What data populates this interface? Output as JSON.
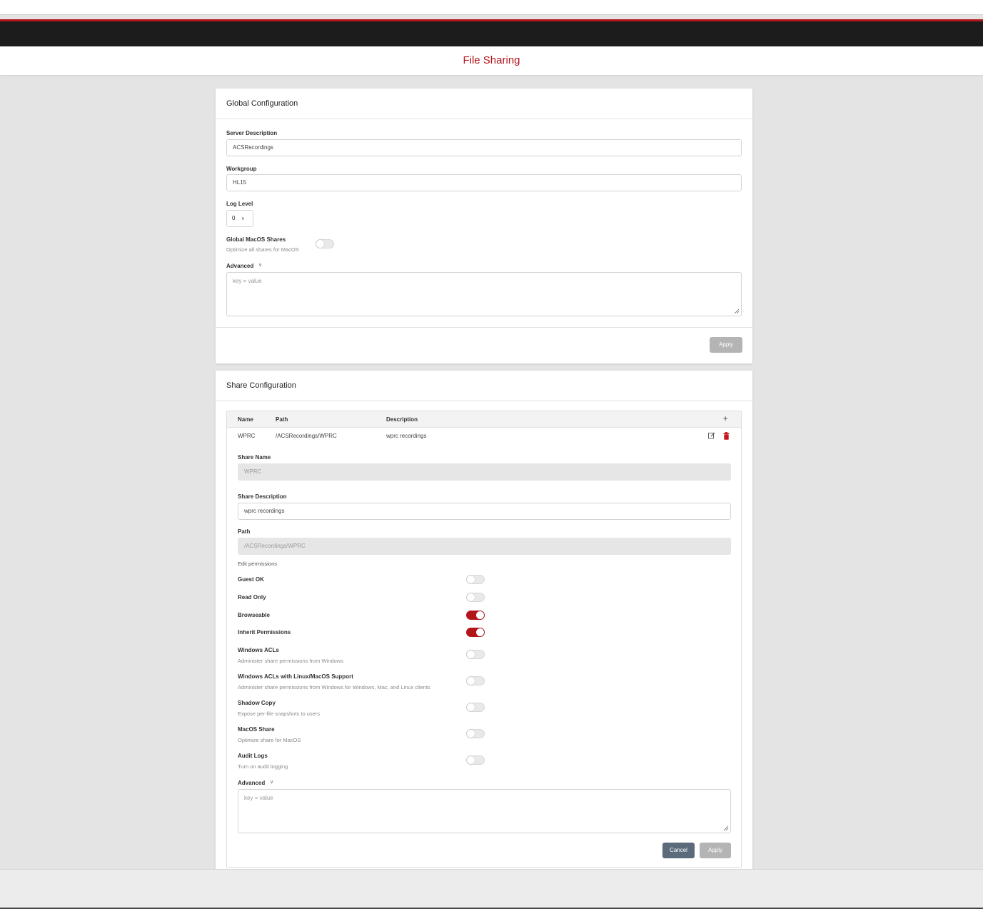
{
  "header": {
    "title": "File Sharing"
  },
  "global": {
    "heading": "Global Configuration",
    "server_description": {
      "label": "Server Description",
      "value": "ACSRecordings"
    },
    "workgroup": {
      "label": "Workgroup",
      "value": "HL15"
    },
    "log_level": {
      "label": "Log Level",
      "value": "0"
    },
    "macos_shares": {
      "label": "Global MacOS Shares",
      "description": "Optimize all shares for MacOS",
      "enabled": false
    },
    "advanced": {
      "label": "Advanced",
      "placeholder": "key = value"
    },
    "apply_label": "Apply"
  },
  "share": {
    "heading": "Share Configuration",
    "columns": [
      "Name",
      "Path",
      "Description"
    ],
    "add_symbol": "+",
    "rows": [
      {
        "name": "WPRC",
        "path": "/ACSRecordings/WPRC",
        "description": "wprc recordings"
      }
    ],
    "share_name": {
      "label": "Share Name",
      "value": "WPRC"
    },
    "share_description": {
      "label": "Share Description",
      "value": "wprc recordings"
    },
    "path": {
      "label": "Path",
      "value": "/ACSRecordings/WPRC"
    },
    "edit_permissions": "Edit permissions",
    "toggles": [
      {
        "label": "Guest OK",
        "description": "",
        "on": false
      },
      {
        "label": "Read Only",
        "description": "",
        "on": false
      },
      {
        "label": "Browseable",
        "description": "",
        "on": true
      },
      {
        "label": "Inherit Permissions",
        "description": "",
        "on": true
      },
      {
        "label": "Windows ACLs",
        "description": "Administer share permissions from Windows",
        "on": false
      },
      {
        "label": "Windows ACLs with Linux/MacOS Support",
        "description": "Administer share permissions from Windows for Windows, Mac, and Linux clients",
        "on": false
      },
      {
        "label": "Shadow Copy",
        "description": "Expose per-file snapshots to users",
        "on": false
      },
      {
        "label": "MacOS Share",
        "description": "Optimize share for MacOS",
        "on": false
      },
      {
        "label": "Audit Logs",
        "description": "Turn on audit logging",
        "on": false
      }
    ],
    "advanced": {
      "label": "Advanced",
      "placeholder": "key = value"
    },
    "cancel_label": "Cancel",
    "apply_label": "Apply"
  },
  "colors": {
    "accent": "#b3151b",
    "topbar": "#1c1c1c",
    "cancel": "#5c6b7c"
  }
}
